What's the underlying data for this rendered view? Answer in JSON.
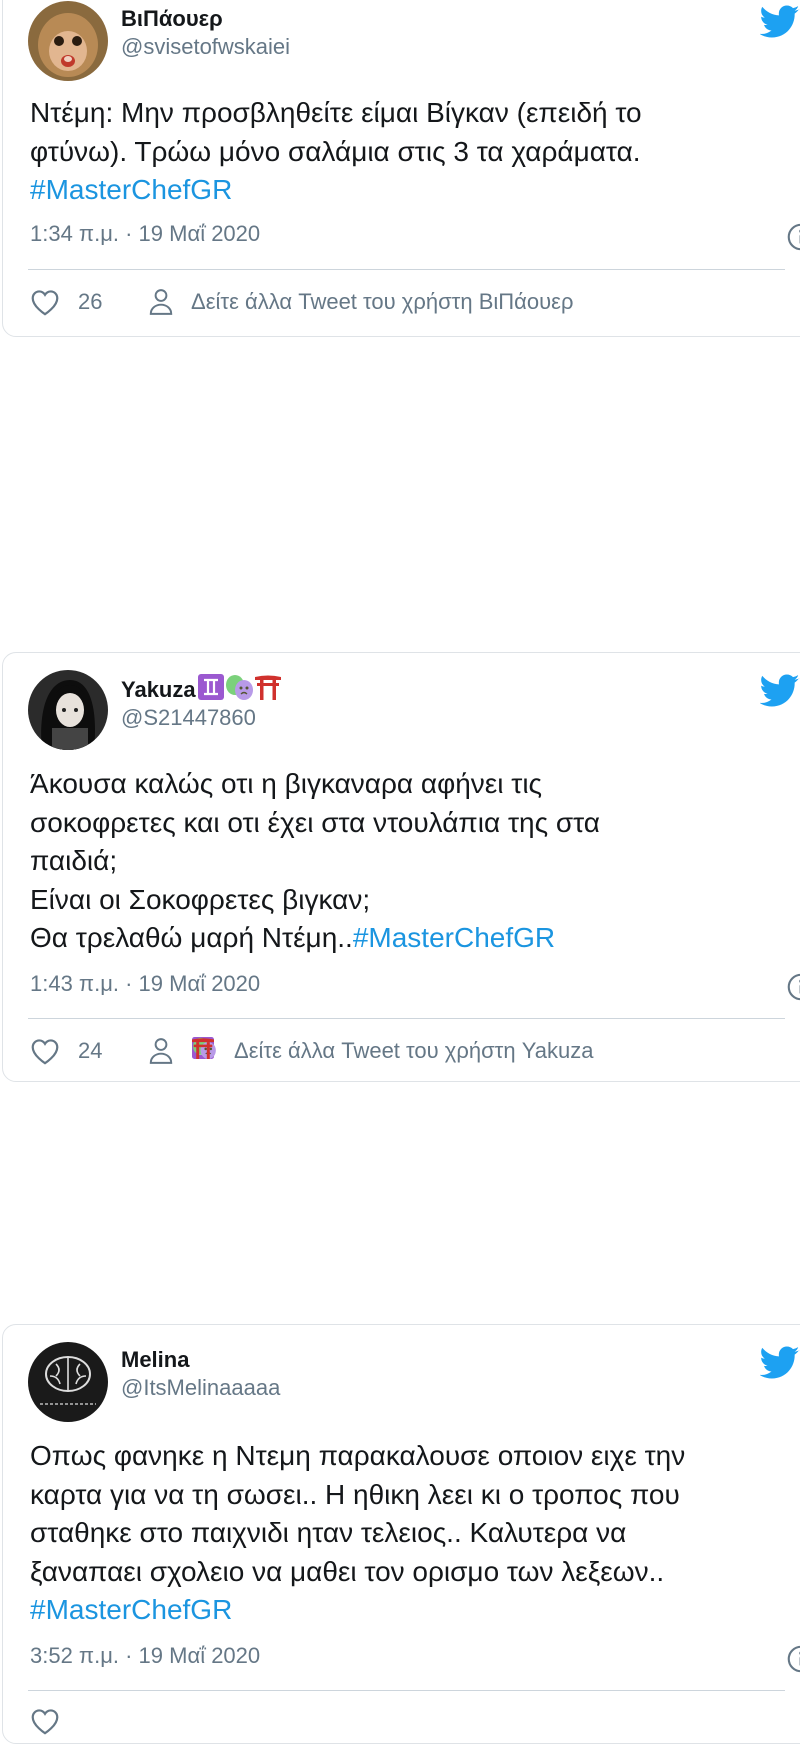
{
  "colors": {
    "hashtag": "#1b95e0",
    "secondary_text": "#657786",
    "twitter_blue": "#1da1f2",
    "border": "#dfe3e7"
  },
  "tweets": [
    {
      "display_name": "ΒιΠάουερ",
      "handle": "@svisetofwskaiei",
      "text": "Ντέμη: Μην προσβληθείτε είμαι Βίγκαν (επειδή το\nφτύνω). Τρώω μόνο σαλάμια στις 3 τα χαράματα.",
      "hashtag": "#MasterChefGR",
      "timestamp": "1:34 π.μ. · 19 Μαΐ 2020",
      "likes": "26",
      "more_tweets": "Δείτε άλλα Tweet του χρήστη ΒιΠάουερ",
      "avatar_icon": "monkey-avatar"
    },
    {
      "display_name": "Yakuza",
      "handle": "@S21447860",
      "text": "Άκουσα καλώς οτι η βιγκαναρα αφήνει τις\nσοκοφρετες και οτι έχει στα ντουλάπια της στα\nπαιδιά;\nΕίναι οι Σοκοφρετες βιγκαν;\nΘα τρελαθώ μαρή Ντέμη..",
      "hashtag": "#MasterChefGR",
      "timestamp": "1:43 π.μ. · 19 Μαΐ 2020",
      "likes": "24",
      "more_tweets": "Δείτε άλλα Tweet του χρήστη Yakuza",
      "name_emojis": [
        "gemini-icon",
        "theater-masks-icon",
        "torii-gate-icon"
      ],
      "avatar_icon": "anime-girl-avatar"
    },
    {
      "display_name": "Melina",
      "handle": "@ItsMelinaaaaa",
      "text": "Οπως φανηκε η Ντεμη παρακαλουσε οποιον ειχε την\nκαρτα για να τη σωσει..  Η ηθικη λεει κι ο τροπος που\nσταθηκε στο παιχνιδι ηταν τελειος.. Καλυτερα να\nξαναπαει σχολειο να μαθει τον ορισμο των λεξεων..",
      "hashtag": "#MasterChefGR",
      "timestamp": "3:52 π.μ. · 19 Μαΐ 2020",
      "avatar_icon": "brain-avatar"
    }
  ]
}
